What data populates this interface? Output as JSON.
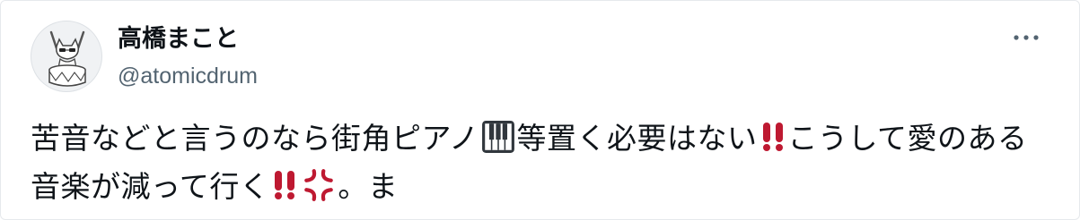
{
  "author": {
    "display_name": "高橋まこと",
    "handle": "@atomicdrum",
    "avatar_icon": "drummer-cat-avatar"
  },
  "post": {
    "more_icon": "more-horizontal-icon",
    "segments": [
      {
        "type": "text",
        "value": "苦音などと言うのなら街角ピアノ"
      },
      {
        "type": "emoji",
        "name": "piano-keys-emoji"
      },
      {
        "type": "text",
        "value": "等置く必要はない"
      },
      {
        "type": "emoji",
        "name": "double-exclamation-emoji"
      },
      {
        "type": "text",
        "value": "こうして愛のある音楽が減って行く"
      },
      {
        "type": "emoji",
        "name": "double-exclamation-emoji"
      },
      {
        "type": "emoji",
        "name": "anger-symbol-emoji"
      },
      {
        "type": "text",
        "value": "。ま"
      }
    ]
  },
  "colors": {
    "text": "#0f1419",
    "secondary": "#536471",
    "emoji_red": "#be1931"
  }
}
